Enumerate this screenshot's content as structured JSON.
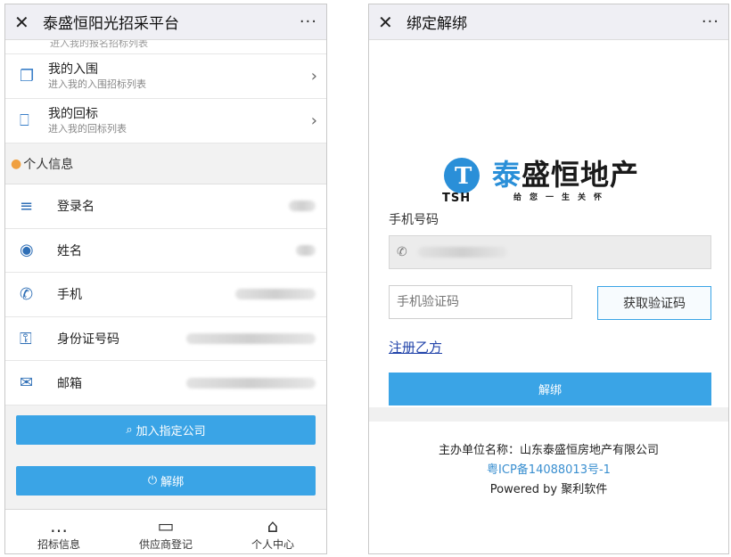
{
  "left": {
    "title": "泰盛恒阳光招采平台",
    "close_glyph": "✕",
    "more_glyph": "···",
    "cut_sub": "进入我的报名招标列表",
    "links": [
      {
        "main": "我的入围",
        "sub": "进入我的入围招标列表",
        "icon": "copy-icon"
      },
      {
        "main": "我的回标",
        "sub": "进入我的回标列表",
        "icon": "bookmark-icon"
      }
    ],
    "section_title": "个人信息",
    "info": [
      {
        "label": "登录名",
        "icon": "list-icon",
        "glyph": "≡"
      },
      {
        "label": "姓名",
        "icon": "user-circle-icon",
        "glyph": "◉"
      },
      {
        "label": "手机",
        "icon": "phone-icon",
        "glyph": "✆"
      },
      {
        "label": "身份证号码",
        "icon": "key-icon",
        "glyph": "⚿"
      },
      {
        "label": "邮箱",
        "icon": "mail-icon",
        "glyph": "✉"
      }
    ],
    "join_button": "加入指定公司",
    "unbind_button": "解绑",
    "tabs": [
      {
        "label": "招标信息",
        "glyph": "…"
      },
      {
        "label": "供应商登记",
        "glyph": "▭"
      },
      {
        "label": "个人中心",
        "glyph": "⌂"
      }
    ]
  },
  "right": {
    "title": "绑定解绑",
    "close_glyph": "✕",
    "more_glyph": "···",
    "logo": {
      "mark": "T",
      "abbr": "TSH",
      "name_first": "泰",
      "name_rest": "盛恒地产",
      "slogan": "给您一生关怀"
    },
    "phone_label": "手机号码",
    "code_placeholder": "手机验证码",
    "get_code_button": "获取验证码",
    "register_link": "注册乙方",
    "unbind_button": "解绑",
    "footer": {
      "org": "主办单位名称：山东泰盛恒房地产有限公司",
      "icp": "粤ICP备14088013号-1",
      "powered": "Powered by 聚利软件"
    }
  },
  "colors": {
    "accent": "#3aa4e6",
    "icon_blue": "#2f6fb6",
    "link": "#2244aa"
  }
}
